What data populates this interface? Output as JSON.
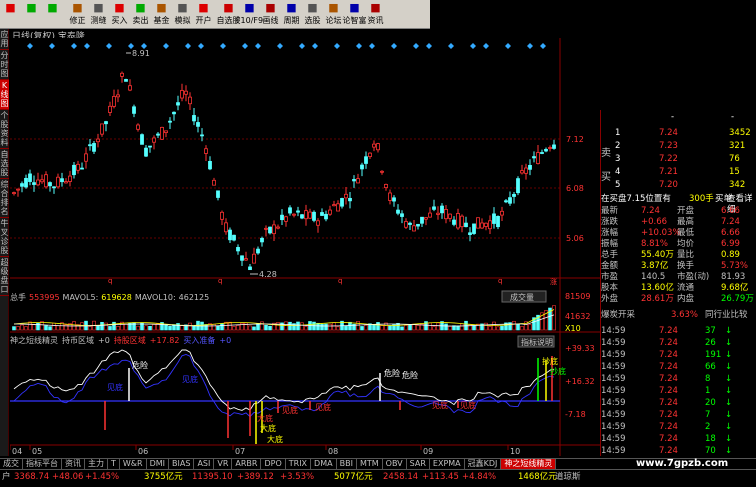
{
  "toolbar": {
    "buttons": [
      {
        "label": "",
        "icon": "grid-icon",
        "color": "#d00"
      },
      {
        "label": "",
        "icon": "left-arrow-icon",
        "color": "#0a0"
      },
      {
        "label": "",
        "icon": "right-arrow-icon",
        "color": "#0a0"
      },
      {
        "label": "修正",
        "icon": "pencil-icon",
        "color": "#a50"
      },
      {
        "label": "测缝",
        "icon": "ruler-icon",
        "color": "#555"
      },
      {
        "label": "买入",
        "icon": "buy-icon",
        "color": "#d00"
      },
      {
        "label": "卖出",
        "icon": "sell-icon",
        "color": "#0a0"
      },
      {
        "label": "基金",
        "icon": "fund-icon",
        "color": "#a50"
      },
      {
        "label": "模拟",
        "icon": "sim-icon",
        "color": "#555"
      },
      {
        "label": "开户",
        "icon": "account-icon",
        "color": "#d00"
      },
      {
        "label": "自选股",
        "icon": "star-icon",
        "color": "#c00"
      },
      {
        "label": "F10/F9",
        "icon": "f10-icon",
        "color": "#00a"
      },
      {
        "label": "画线",
        "icon": "draw-icon",
        "color": "#a00"
      },
      {
        "label": "周期",
        "icon": "period-icon",
        "color": "#00a"
      },
      {
        "label": "选股",
        "icon": "filter-icon",
        "color": "#555"
      },
      {
        "label": "论坛",
        "icon": "forum-icon",
        "color": "#a50"
      },
      {
        "label": "论智富",
        "icon": "wisdom-icon",
        "color": "#00a"
      },
      {
        "label": "资讯",
        "icon": "news-icon",
        "color": "#a00"
      }
    ]
  },
  "leftbar": [
    "应用",
    "分时图",
    "K线图",
    "个股资料",
    "自选股",
    "综合排名",
    "牛叉诊股",
    "超级盘口"
  ],
  "chart": {
    "title": "日线(复权) 宝泰隆",
    "high_label": "8.91",
    "low_label": "4.28",
    "y_ticks": [
      "7.12",
      "6.08",
      "5.06"
    ],
    "vol_header": {
      "prefix": "总手",
      "total": "553995",
      "mavol5_label": "MAVOL5:",
      "mavol5": "619628",
      "mavol10_label": "MAVOL10:",
      "mavol10": "462125"
    },
    "vol_button": "成交量",
    "vol_ticks": [
      "81509",
      "41632",
      "X10"
    ],
    "ind_header": {
      "name": "神之短线精灵",
      "sub": "持币区域",
      "v1": "+0",
      "t2": "持股区域",
      "v2": "+17.82",
      "t3": "买入准备",
      "v3": "+0"
    },
    "ind_button": "指标说明",
    "ind_ticks": [
      "+39.33",
      "+16.32",
      "-7.18"
    ],
    "ind_labels": [
      "危险",
      "危险",
      "危险",
      "大底",
      "大底",
      "大底",
      "见底",
      "见底",
      "见底",
      "见底",
      "见底",
      "见底",
      "抄底",
      "抄底"
    ],
    "x_ticks": [
      "04",
      "05",
      "06",
      "07",
      "08",
      "09",
      "10"
    ]
  },
  "quote": {
    "sell_label": "卖",
    "buy_label": "买",
    "sell": [
      [
        "1",
        "7.24",
        "3452"
      ],
      [
        "2",
        "7.23",
        "321"
      ],
      [
        "3",
        "7.22",
        "76"
      ],
      [
        "4",
        "7.21",
        "15"
      ],
      [
        "5",
        "7.20",
        "342"
      ]
    ],
    "top_row": [
      "-",
      "-"
    ],
    "inner_header": "在买盘7.15位置有",
    "inner_vol": "300手",
    "detail_button": "买单",
    "detail_link": "查看详细",
    "stats": [
      [
        "最新",
        "7.24",
        "开盘",
        "6.66"
      ],
      [
        "涨跌",
        "+0.66",
        "最高",
        "7.24"
      ],
      [
        "涨幅",
        "+10.03%",
        "最低",
        "6.66"
      ],
      [
        "振幅",
        "8.81%",
        "均价",
        "6.99"
      ],
      [
        "总手",
        "55.40万",
        "量比",
        "0.89"
      ],
      [
        "金额",
        "3.87亿",
        "换手",
        "5.73%"
      ],
      [
        "市盈",
        "140.5",
        "市盈(动)",
        "81.93"
      ],
      [
        "股本",
        "13.60亿",
        "流通",
        "9.68亿"
      ],
      [
        "外盘",
        "28.61万",
        "内盘",
        "26.79万"
      ]
    ],
    "news1": "爆炭开采",
    "news1_val": "3.63%",
    "news2": "同行业比较",
    "ticks": [
      [
        "14:59",
        "7.24",
        "37",
        "↓"
      ],
      [
        "14:59",
        "7.24",
        "26",
        "↓"
      ],
      [
        "14:59",
        "7.24",
        "191",
        "↓"
      ],
      [
        "14:59",
        "7.24",
        "66",
        "↓"
      ],
      [
        "14:59",
        "7.24",
        "8",
        "↓"
      ],
      [
        "14:59",
        "7.24",
        "1",
        "↓"
      ],
      [
        "14:59",
        "7.24",
        "20",
        "↓"
      ],
      [
        "14:59",
        "7.24",
        "7",
        "↓"
      ],
      [
        "14:59",
        "7.24",
        "2",
        "↓"
      ],
      [
        "14:59",
        "7.24",
        "18",
        "↓"
      ],
      [
        "14:59",
        "7.24",
        "70",
        "↓"
      ]
    ]
  },
  "tabs": [
    "成交",
    "指标平台",
    "资讯",
    "主力",
    "T",
    "W&R",
    "DMI",
    "BIAS",
    "ASI",
    "VR",
    "ARBR",
    "DPO",
    "TRIX",
    "DMA",
    "BBI",
    "MTM",
    "OBV",
    "SAR",
    "EXPMA",
    "冠鑫KDJ",
    "神之短线精灵"
  ],
  "status": {
    "s1": "户",
    "s2": "3368.74",
    "s3": "+48.06",
    "s4": "+1.45%",
    "s5": "3755亿元",
    "s6": "11395.10",
    "s7": "+389.12",
    "s8": "+3.53%",
    "s9": "5077亿元",
    "s10": "2458.14",
    "s11": "+113.45",
    "s12": "+4.84%",
    "s13": "1468亿元",
    "s14": "道琼斯"
  },
  "watermark": "www.7gpzb.com"
}
